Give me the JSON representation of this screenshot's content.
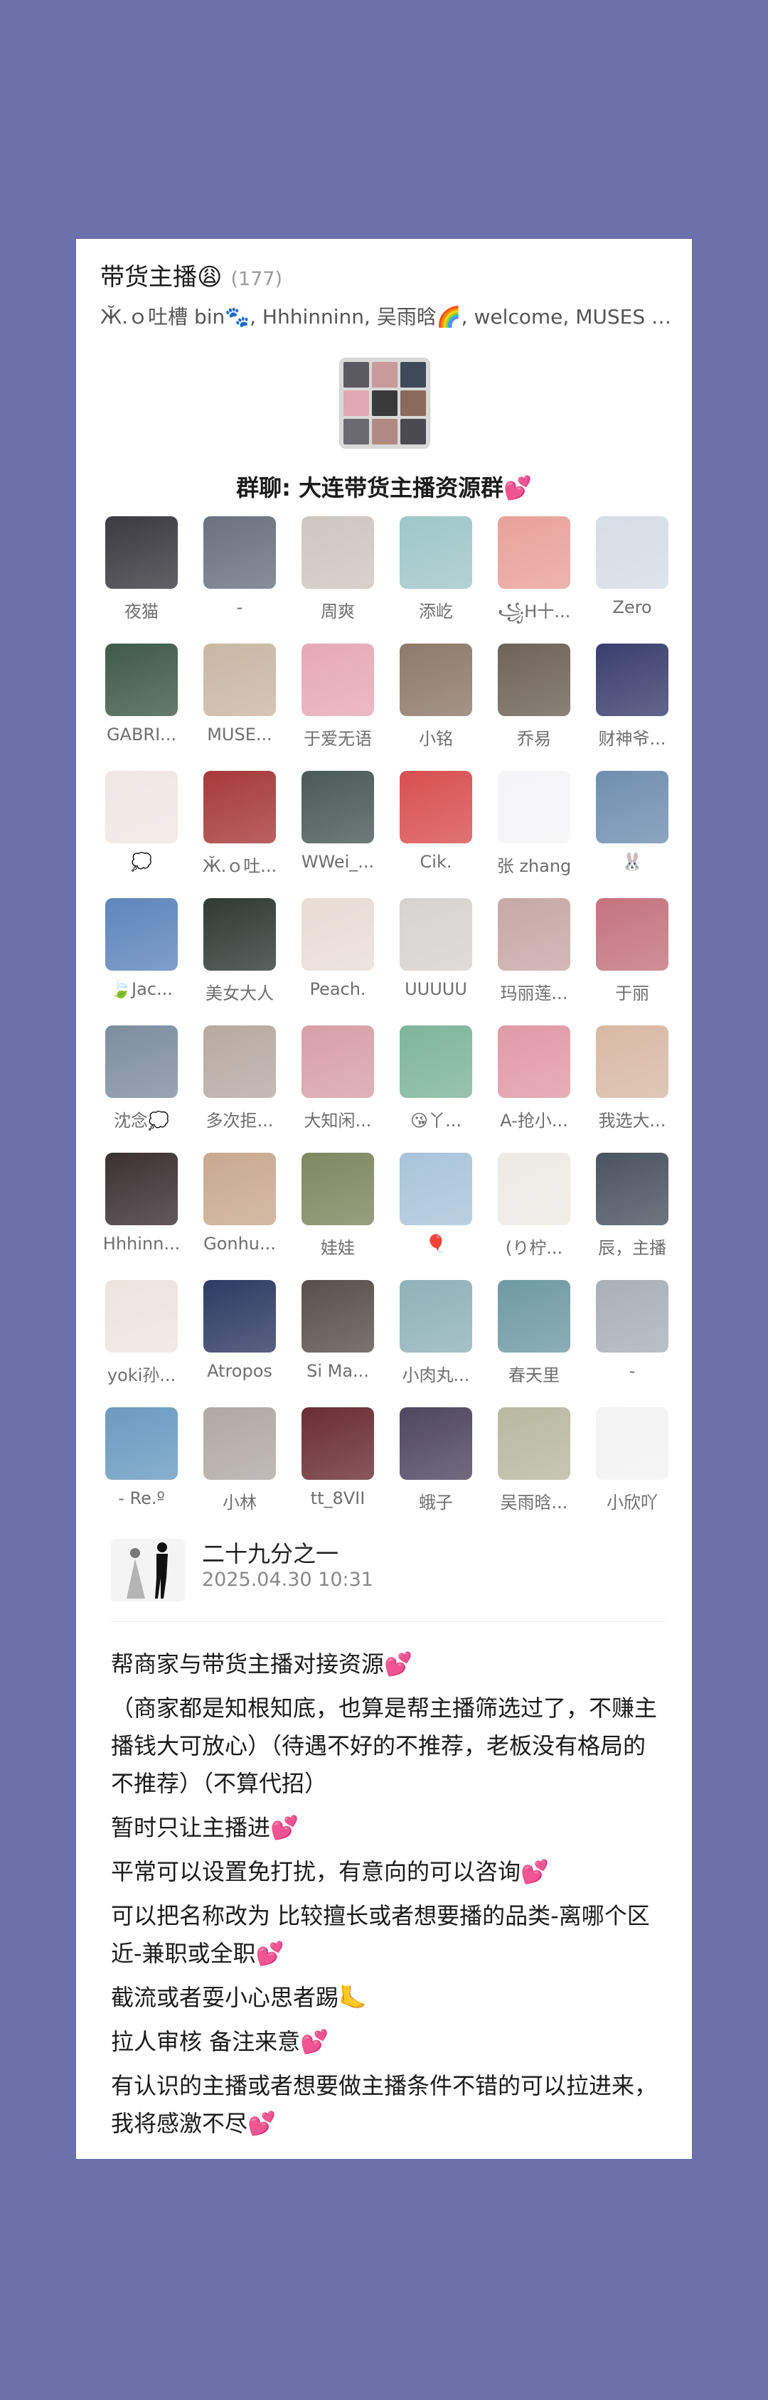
{
  "group": {
    "name": "带货主播😩",
    "count": "(177)",
    "members_line": "Ӂ.ｏ吐槽 bin🐾, Hhhinninn, 吴雨晗🌈, welcome, MUSES 晨,..."
  },
  "chat_title": "群聊: 大连带货主播资源群💕",
  "members": [
    {
      "name": "夜猫",
      "color": "#3a3a40"
    },
    {
      "name": "-",
      "color": "#6a7280"
    },
    {
      "name": "周爽",
      "color": "#cfc6c0"
    },
    {
      "name": "添屹",
      "color": "#9fc7c8"
    },
    {
      "name": "꧁H十...",
      "color": "#e8a29a"
    },
    {
      "name": "Zero",
      "color": "#d7dde6"
    },
    {
      "name": "GABRI...",
      "color": "#3f5a4a"
    },
    {
      "name": "MUSE...",
      "color": "#c9b7a4"
    },
    {
      "name": "于爱无语",
      "color": "#e6a9b7"
    },
    {
      "name": "小铭",
      "color": "#8d7a6a"
    },
    {
      "name": "乔易",
      "color": "#6e6356"
    },
    {
      "name": "财神爷...",
      "color": "#3b3f6e"
    },
    {
      "name": "💭",
      "color": "#efe7e4"
    },
    {
      "name": "Ӂ.ｏ吐...",
      "color": "#a63a3a"
    },
    {
      "name": "WWei_...",
      "color": "#4a5a56"
    },
    {
      "name": "Cik.",
      "color": "#d85050"
    },
    {
      "name": "张 zhang",
      "color": "#f5f5f7"
    },
    {
      "name": "🐰",
      "color": "#6f8fb0"
    },
    {
      "name": "🍃Jac...",
      "color": "#5f86bc"
    },
    {
      "name": "美女大人",
      "color": "#2f3a35"
    },
    {
      "name": "Peach.",
      "color": "#e9ddd5"
    },
    {
      "name": "UUUUU",
      "color": "#d6d3d0"
    },
    {
      "name": "玛丽莲...",
      "color": "#c7a8a6"
    },
    {
      "name": "于丽",
      "color": "#c4747e"
    },
    {
      "name": "沈念💭",
      "color": "#7e8ea0"
    },
    {
      "name": "多次拒...",
      "color": "#b7aaa2"
    },
    {
      "name": "大知闲...",
      "color": "#d7a0a8"
    },
    {
      "name": "😘丫...",
      "color": "#7fb59c"
    },
    {
      "name": "A-抢小...",
      "color": "#e09aa7"
    },
    {
      "name": "我选大...",
      "color": "#d8b9a4"
    },
    {
      "name": "Hhhinn...",
      "color": "#3a3133"
    },
    {
      "name": "Gonhu...",
      "color": "#c9a98f"
    },
    {
      "name": "娃娃",
      "color": "#7f8760"
    },
    {
      "name": "🎈",
      "color": "#a9c4d9"
    },
    {
      "name": "(り柠...",
      "color": "#eeeae6"
    },
    {
      "name": "辰，主播",
      "color": "#4a5460"
    },
    {
      "name": "yoki孙...",
      "color": "#ede4df"
    },
    {
      "name": "Atropos",
      "color": "#2e3b63"
    },
    {
      "name": "Si Ma...",
      "color": "#59504a"
    },
    {
      "name": "小肉丸...",
      "color": "#8fb2b8"
    },
    {
      "name": "春天里",
      "color": "#6f9aa3"
    },
    {
      "name": "-",
      "color": "#a9b0b6"
    },
    {
      "name": "-  Re.º",
      "color": "#6b9bc0"
    },
    {
      "name": "小林",
      "color": "#b0a9a6"
    },
    {
      "name": "tt_8VII",
      "color": "#6a2e33"
    },
    {
      "name": "蛾子",
      "color": "#4f4660"
    },
    {
      "name": "吴雨晗...",
      "color": "#b8b9a0"
    },
    {
      "name": "小欣吖",
      "color": "#f3f3f3"
    }
  ],
  "group_avatar_colors": [
    "#5a5a60",
    "#c89a9a",
    "#3e4a5a",
    "#e0a8b0",
    "#3a3a3a",
    "#8a6a5a",
    "#6a6a70",
    "#b08a80",
    "#4a4a50"
  ],
  "poster": {
    "name": "二十九分之一",
    "time": "2025.04.30  10:31"
  },
  "announcement": [
    "帮商家与带货主播对接资源💕",
    "（商家都是知根知底，也算是帮主播筛选过了，不赚主播钱大可放心）（待遇不好的不推荐，老板没有格局的不推荐）（不算代招）",
    "暂时只让主播进💕",
    "平常可以设置免打扰，有意向的可以咨询💕",
    "可以把名称改为 比较擅长或者想要播的品类-离哪个区近-兼职或全职💕",
    "截流或者耍小心思者踢🦶",
    "拉人审核 备注来意💕",
    "有认识的主播或者想要做主播条件不错的可以拉进来，我将感激不尽💕"
  ]
}
